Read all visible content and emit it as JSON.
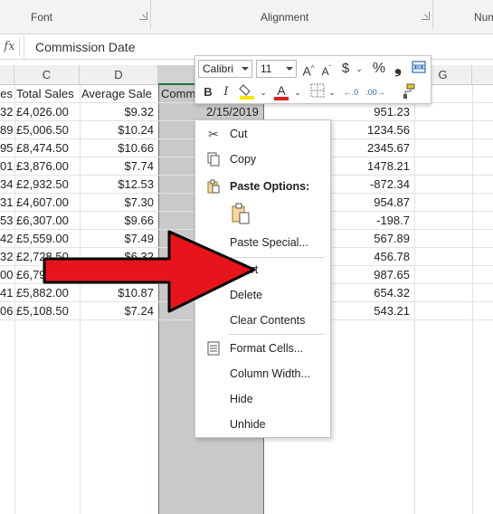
{
  "ribbon": {
    "groups": [
      {
        "label": "Font"
      },
      {
        "label": "Alignment"
      },
      {
        "label": "Num"
      }
    ]
  },
  "formula_bar": {
    "fx_label": "fx",
    "value": "Commission Date"
  },
  "columns": [
    "C",
    "D",
    "G"
  ],
  "column_headers_row": {
    "b_partial": "es",
    "c": "Total Sales",
    "d": "Average Sale",
    "e_partial": "Comm"
  },
  "rows": [
    {
      "b": "32",
      "c": "£4,026.00",
      "d": "$9.32",
      "e": "2/15/2019",
      "f": "951.23"
    },
    {
      "b": "89",
      "c": "£5,006.50",
      "d": "$10.24",
      "e": "",
      "f": "1234.56"
    },
    {
      "b": "95",
      "c": "£8,474.50",
      "d": "$10.66",
      "e": "",
      "f": "2345.67"
    },
    {
      "b": "01",
      "c": "£3,876.00",
      "d": "$7.74",
      "e": "",
      "f": "1478.21"
    },
    {
      "b": "34",
      "c": "£2,932.50",
      "d": "$12.53",
      "e": "",
      "f": "-872.34"
    },
    {
      "b": "31",
      "c": "£4,607.00",
      "d": "$7.30",
      "e": "",
      "f": "954.87"
    },
    {
      "b": "53",
      "c": "£6,307.00",
      "d": "$9.66",
      "e": "",
      "f": "-198.7"
    },
    {
      "b": "42",
      "c": "£5,559.00",
      "d": "$7.49",
      "e": "",
      "f": "567.89"
    },
    {
      "b": "32",
      "c": "£2,728.50",
      "d": "$6.32",
      "e": "",
      "f": "456.78"
    },
    {
      "b": "00",
      "c": "£6,79",
      "d": "",
      "e": "",
      "f": "987.65"
    },
    {
      "b": "41",
      "c": "£5,882.00",
      "d": "$10.87",
      "e": "",
      "f": "654.32"
    },
    {
      "b": "06",
      "c": "£5,108.50",
      "d": "$7.24",
      "e": "",
      "f": "543.21"
    }
  ],
  "mini_toolbar": {
    "font_name": "Calibri",
    "font_size": "11",
    "grow_font": "A",
    "shrink_font": "A",
    "currency": "$",
    "percent": "%",
    "comma": "❟",
    "bold": "B",
    "italic": "I",
    "font_color_glyph": "A",
    "decrease_decimal": "←.0",
    "increase_decimal": ".00→"
  },
  "context_menu": {
    "cut": "Cut",
    "copy": "Copy",
    "paste_options": "Paste Options:",
    "paste_special": "Paste Special...",
    "insert": "Insert",
    "delete": "Delete",
    "clear_contents": "Clear Contents",
    "format_cells": "Format Cells...",
    "column_width": "Column Width...",
    "hide": "Hide",
    "unhide": "Unhide"
  },
  "colors": {
    "accent_green": "#217346",
    "arrow_red": "#e8141b",
    "selection_gray": "#c9c9c9",
    "highlight_yellow": "#ffe600",
    "font_red": "#e02020"
  }
}
